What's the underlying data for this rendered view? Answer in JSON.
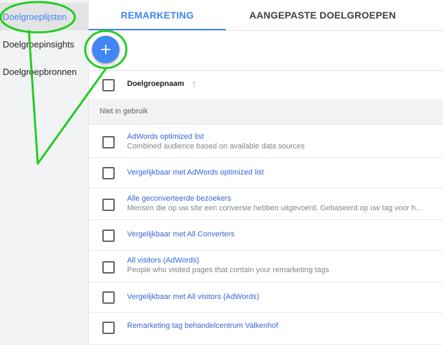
{
  "sidebar": {
    "items": [
      {
        "label": "Doelgroeplijsten",
        "active": true
      },
      {
        "label": "Doelgroepinsights",
        "active": false
      },
      {
        "label": "Doelgroepbronnen",
        "active": false
      }
    ]
  },
  "tabs": [
    {
      "label": "REMARKETING",
      "active": true
    },
    {
      "label": "AANGEPASTE DOELGROEPEN",
      "active": false
    }
  ],
  "fab": {
    "icon": "plus-icon",
    "label": "+"
  },
  "table": {
    "header": {
      "name_column": "Doelgroepnaam",
      "sort_icon": "arrow-up-icon",
      "sort_glyph": "↑"
    },
    "group_label": "Niet in gebruik",
    "rows": [
      {
        "name": "AdWords optimized list",
        "desc": "Combined audience based on available data sources"
      },
      {
        "name": "Vergelijkbaar met AdWords optimized list",
        "desc": ""
      },
      {
        "name": "Alle geconverteerde bezoekers",
        "desc": "Mensen die op uw site een conversie hebben uitgevoerd. Gebaseerd op uw tag voor h..."
      },
      {
        "name": "Vergelijkbaar met All Converters",
        "desc": ""
      },
      {
        "name": "All visitors (AdWords)",
        "desc": "People who visited pages that contain your remarketing tags"
      },
      {
        "name": "Vergelijkbaar met All visitors (AdWords)",
        "desc": ""
      },
      {
        "name": "Remarketing tag behandelcentrum Valkenhof",
        "desc": ""
      }
    ]
  },
  "colors": {
    "accent": "#4285f4",
    "link": "#3367d6",
    "annotation": "#22cc22"
  }
}
